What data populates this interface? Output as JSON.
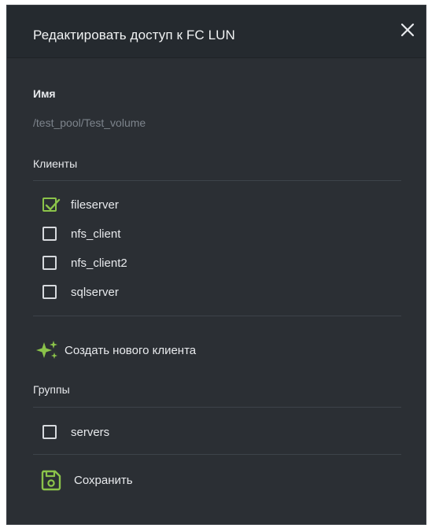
{
  "dialog": {
    "title": "Редактировать доступ к FC LUN",
    "close_icon": "close-icon"
  },
  "name_section": {
    "label": "Имя",
    "value": "/test_pool/Test_volume"
  },
  "clients_section": {
    "label": "Клиенты",
    "items": [
      {
        "label": "fileserver",
        "checked": true
      },
      {
        "label": "nfs_client",
        "checked": false
      },
      {
        "label": "nfs_client2",
        "checked": false
      },
      {
        "label": "sqlserver",
        "checked": false
      }
    ]
  },
  "create_client": {
    "label": "Создать нового клиента",
    "icon": "sparkle-icon"
  },
  "groups_section": {
    "label": "Группы",
    "items": [
      {
        "label": "servers",
        "checked": false
      }
    ]
  },
  "save": {
    "label": "Сохранить",
    "icon": "save-icon"
  },
  "colors": {
    "panel": "#2b2f34",
    "header": "#252a2f",
    "accent": "#8bc34a"
  }
}
